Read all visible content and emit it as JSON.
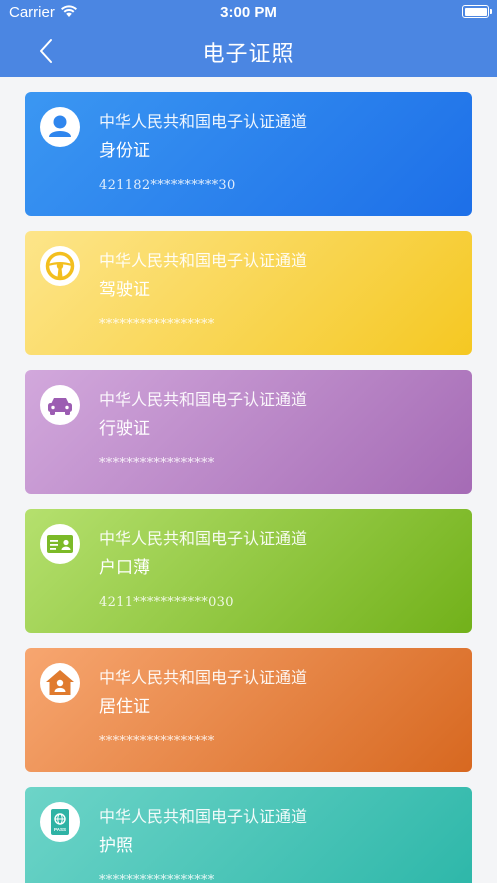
{
  "status_bar": {
    "carrier": "Carrier",
    "time": "3:00 PM"
  },
  "nav": {
    "title": "电子证照",
    "back_icon": "chevron-left-icon"
  },
  "colors": {
    "header": "#4b86e2",
    "background": "#f4f5f7"
  },
  "cards": [
    {
      "channel": "中华人民共和国电子认证通道",
      "title": "身份证",
      "number": "421182**********30",
      "icon": "person-icon",
      "color": "#2a82ee"
    },
    {
      "channel": "中华人民共和国电子认证通道",
      "title": "驾驶证",
      "number": "*****************",
      "icon": "steering-wheel-icon",
      "color": "#f8d54a"
    },
    {
      "channel": "中华人民共和国电子认证通道",
      "title": "行驶证",
      "number": "*****************",
      "icon": "car-icon",
      "color": "#bb86c8"
    },
    {
      "channel": "中华人民共和国电子认证通道",
      "title": "户口薄",
      "number": "4211***********030",
      "icon": "id-card-icon",
      "color": "#93c843"
    },
    {
      "channel": "中华人民共和国电子认证通道",
      "title": "居住证",
      "number": "*****************",
      "icon": "house-person-icon",
      "color": "#e78840"
    },
    {
      "channel": "中华人民共和国电子认证通道",
      "title": "护照",
      "number": "*****************",
      "icon": "passport-icon",
      "color": "#4cc6b8"
    }
  ],
  "passport_icon_text": "PASS"
}
